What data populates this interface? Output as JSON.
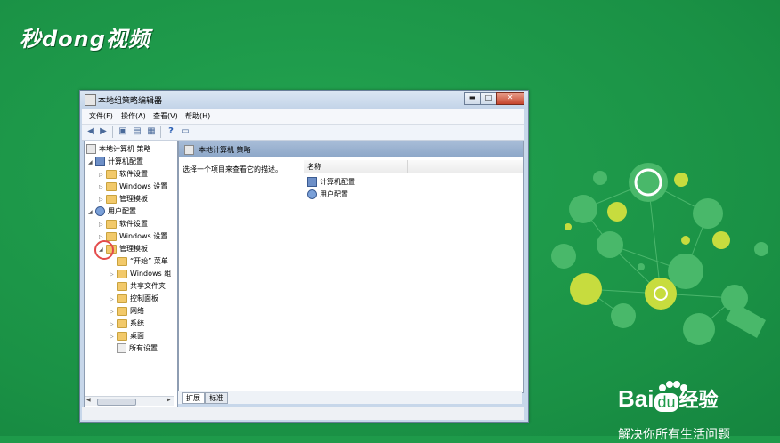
{
  "logo_text": "秒dong视频",
  "baidu": {
    "brand_a": "Bai",
    "brand_du": "du",
    "brand_b": "经验",
    "tagline": "解决你所有生活问题"
  },
  "window": {
    "title": "本地组策略编辑器",
    "minimize": "▬",
    "maximize": "□",
    "close": "✕"
  },
  "menubar": [
    "文件(F)",
    "操作(A)",
    "查看(V)",
    "帮助(H)"
  ],
  "tree": {
    "root": "本地计算机 策略",
    "computer_config": "计算机配置",
    "cc_software": "软件设置",
    "cc_windows": "Windows 设置",
    "cc_admin": "管理模板",
    "user_config": "用户配置",
    "uc_software": "软件设置",
    "uc_windows": "Windows 设置",
    "uc_admin": "管理模板",
    "start_menu": "“开始” 菜单",
    "windows_comp": "Windows 组",
    "shared_folders": "共享文件夹",
    "control_panel": "控制面板",
    "network": "网络",
    "system": "系统",
    "desktop": "桌面",
    "all_settings": "所有设置"
  },
  "right": {
    "header": "本地计算机 策略",
    "description": "选择一个项目来查看它的描述。",
    "column_name": "名称",
    "items": [
      "计算机配置",
      "用户配置"
    ]
  },
  "tabs": [
    "扩展",
    "标准"
  ]
}
